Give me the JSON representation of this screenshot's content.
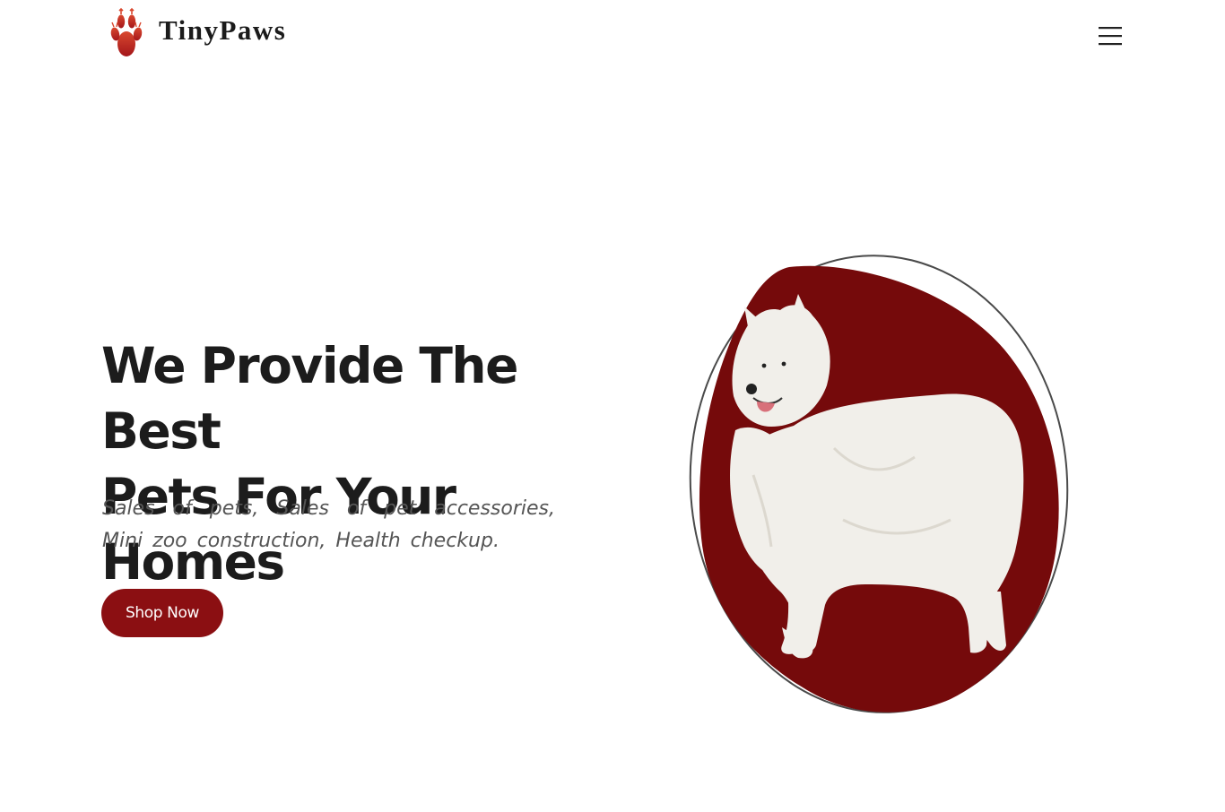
{
  "navbar": {
    "brand_name": "TinyPaws",
    "logo_icon": "paw-icon",
    "menu_icon": "hamburger-icon"
  },
  "hero": {
    "title_line1": "We Provide The Best",
    "title_line2": "Pets For Your Homes",
    "subtitle": "Sales of pets, Sales of pet accessories, Mini zoo construction, Health checkup.",
    "cta_label": "Shop Now",
    "image_subject": "white-samoyed-dog"
  },
  "colors": {
    "accent": "#8b0f12",
    "blob": "#750a0b",
    "paw": "#c0392b",
    "text": "#1c1c1c",
    "muted": "#555555"
  }
}
